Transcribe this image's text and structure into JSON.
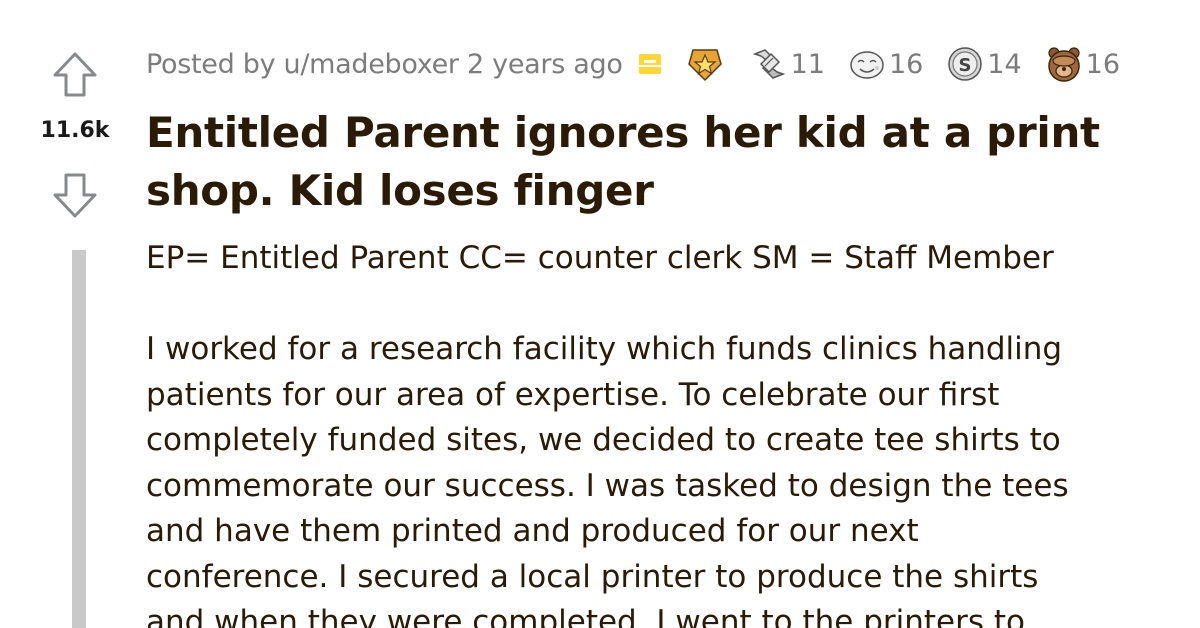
{
  "post": {
    "score": "11.6k",
    "meta": {
      "posted_by_prefix": "Posted by ",
      "username": "u/madeboxer",
      "age": " 2 years ago"
    },
    "awards": [
      {
        "icon": "gold-star-award-icon",
        "count": ""
      },
      {
        "icon": "helpful-hands-award-icon",
        "count": "11"
      },
      {
        "icon": "wholesome-face-award-icon",
        "count": "16"
      },
      {
        "icon": "silver-coin-award-icon",
        "count": "14"
      },
      {
        "icon": "facepalm-bear-award-icon",
        "count": "16"
      }
    ],
    "title": "Entitled Parent ignores her kid at a print shop. Kid loses finger",
    "title_lines": [
      "Entitled Parent ignores her kid at a print",
      "shop. Kid loses finger"
    ],
    "body_intro": "EP= Entitled Parent CC= counter clerk SM = Staff Member",
    "body_lines": [
      "I worked for a research facility which funds clinics handling",
      "patients for our area of expertise. To celebrate our first",
      "completely funded sites, we decided to create tee shirts to",
      "commemorate our success. I was tasked to design the tees",
      "and have them printed and produced for our next",
      "conference. I secured a local printer to produce the shirts",
      "and when they were completed, I went to the printers to"
    ]
  },
  "colors": {
    "text": "#2b1a06",
    "meta": "#7c7c7c",
    "thread_line": "#c9c9c9",
    "archive": "#ffd635"
  }
}
